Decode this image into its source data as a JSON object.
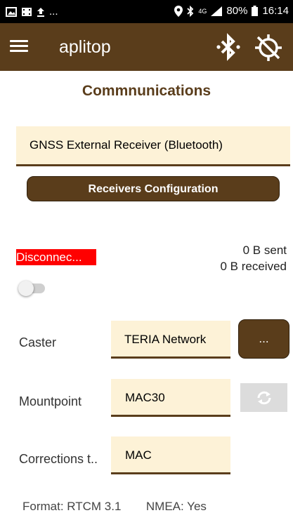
{
  "status_bar": {
    "notification_icons": [
      "image-icon",
      "media-icon",
      "upload-icon"
    ],
    "more": "...",
    "network": "4G",
    "battery": "80%",
    "time": "16:14"
  },
  "app_bar": {
    "title": "aplitop",
    "icons": [
      "menu-icon",
      "bluetooth-icon",
      "gps-off-icon"
    ]
  },
  "page": {
    "title": "Commnunications",
    "receiver_select": "GNSS External Receiver (Bluetooth)",
    "receivers_config_label": "Receivers Configuration"
  },
  "connection": {
    "status": "Disconnec...",
    "sent": "0 B sent",
    "received": "0 B received",
    "toggle_on": false
  },
  "fields": {
    "caster_label": "Caster",
    "caster_value": "TERIA Network",
    "caster_button": "...",
    "mountpoint_label": "Mountpoint",
    "mountpoint_value": "MAC30",
    "corrections_label": "Corrections t..",
    "corrections_value": "MAC"
  },
  "footer": {
    "format": "Format: RTCM 3.1",
    "nmea": "NMEA: Yes"
  },
  "colors": {
    "brand": "#5a3d1b",
    "field_bg": "#fdf2d7",
    "error": "#ff0000"
  }
}
